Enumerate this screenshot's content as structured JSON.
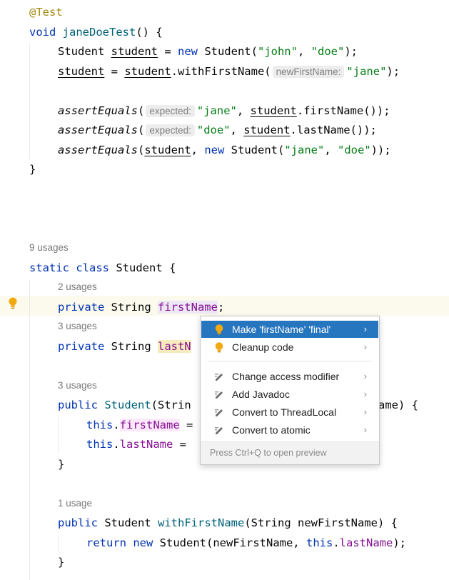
{
  "code": {
    "l1": {
      "annotation": "@Test"
    },
    "l2": {
      "kw": "void",
      "method": "janeDoeTest",
      "tail": "() {"
    },
    "l3": {
      "type": "Student ",
      "var": "student",
      "eq": " = ",
      "kw": "new",
      "call": " Student(",
      "s1": "\"john\"",
      "comma": ", ",
      "s2": "\"doe\"",
      "end": ");"
    },
    "l4": {
      "var": "student",
      "eq": " = ",
      "var2": "student",
      "dot": ".withFirstName(",
      "hint": "newFirstName:",
      "s": "\"jane\"",
      "end": ");"
    },
    "l5": {
      "fn": "assertEquals",
      "open": "(",
      "hint": "expected:",
      "s": "\"jane\"",
      "comma": ", ",
      "var": "student",
      "rest": ".firstName());"
    },
    "l6": {
      "fn": "assertEquals",
      "open": "(",
      "hint": "expected:",
      "s": "\"doe\"",
      "comma": ", ",
      "var": "student",
      "rest": ".lastName());"
    },
    "l7": {
      "fn": "assertEquals",
      "open": "(",
      "var": "student",
      "comma": ", ",
      "kw": "new",
      "call": " Student(",
      "s1": "\"jane\"",
      "comma2": ", ",
      "s2": "\"doe\"",
      "end": "));"
    },
    "l8": {
      "brace": "}"
    },
    "u1": "9 usages",
    "l9": {
      "kw1": "static",
      "kw2": "class",
      "name": " Student {"
    },
    "u2": "2 usages",
    "l10": {
      "kw": "private",
      "type": " String ",
      "field": "firstName",
      "end": ";"
    },
    "u3": "3 usages",
    "l11": {
      "kw": "private",
      "type": " String ",
      "field": "lastN"
    },
    "u4": "3 usages",
    "l12": {
      "kw": "public",
      "ctor": "Student",
      "rest": "(Strin",
      "tail": "ame) {"
    },
    "l13": {
      "kw": "this",
      "dot": ".",
      "field": "firstName",
      "eq": " ="
    },
    "l14": {
      "kw": "this",
      "dot": ".",
      "field": "lastName",
      "eq": " ="
    },
    "l15": {
      "brace": "}"
    },
    "u5": "1 usage",
    "l16": {
      "kw": "public",
      "type": " Student ",
      "method": "withFirstName",
      "rest": "(String newFirstName) {"
    },
    "l17": {
      "kw1": "return",
      "kw2": "new",
      "call": " Student(newFirstName, ",
      "kw3": "this",
      "dot": ".",
      "field": "lastName",
      "end": ");"
    },
    "l18": {
      "brace": "}"
    }
  },
  "popup": {
    "items": [
      {
        "label": "Make 'firstName' 'final'",
        "icon": "bulb-icon"
      },
      {
        "label": "Cleanup code",
        "icon": "bulb-icon"
      },
      {
        "label": "Change access modifier",
        "icon": "pencil-icon"
      },
      {
        "label": "Add Javadoc",
        "icon": "pencil-icon"
      },
      {
        "label": "Convert to ThreadLocal",
        "icon": "pencil-icon"
      },
      {
        "label": "Convert to atomic",
        "icon": "pencil-icon"
      }
    ],
    "chevron": "›",
    "footer": "Press Ctrl+Q to open preview"
  },
  "colors": {
    "keyword": "#0033b3",
    "string": "#067d17",
    "field": "#871094",
    "method": "#00627a",
    "annotation": "#9e880d",
    "selection": "#2675bf",
    "bulb": "#f2a911"
  }
}
